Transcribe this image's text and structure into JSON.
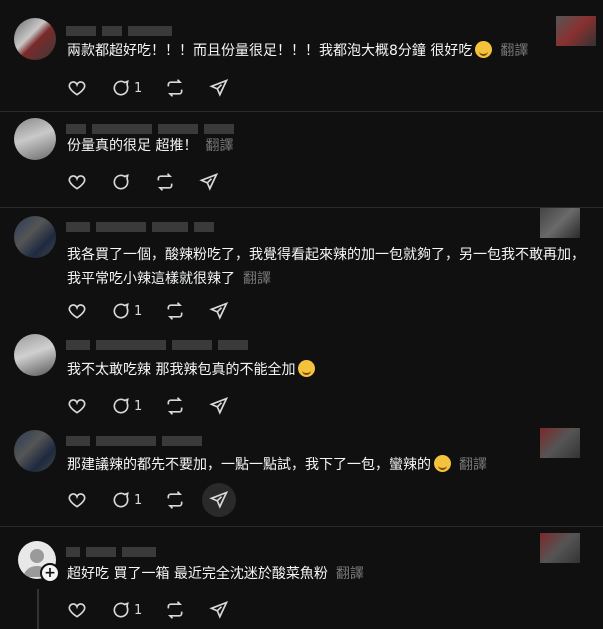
{
  "translate_label": "翻譯",
  "comments": [
    {
      "text": "兩款都超好吃！！！而且份量很足！！！我都泡大概8分鐘 很好吃",
      "emoji": "smiling-face",
      "reply_count": "1",
      "show_reply_count": true
    },
    {
      "text": "份量真的很足 超推！",
      "emoji": "",
      "reply_count": "",
      "show_reply_count": false
    },
    {
      "text": "我各買了一個，酸辣粉吃了，我覺得看起來辣的加一包就夠了，另一包我不敢再加，我平常吃小辣這樣就很辣了",
      "emoji": "",
      "reply_count": "1",
      "show_reply_count": true
    },
    {
      "text": "我不太敢吃辣 那我辣包真的不能全加",
      "emoji": "rolling-laughing-face",
      "reply_count": "1",
      "show_reply_count": true
    },
    {
      "text": "那建議辣的都先不要加，一點一點試，我下了一包，蠻辣的",
      "emoji": "rolling-laughing-face",
      "reply_count": "1",
      "show_reply_count": true
    },
    {
      "text": "超好吃 買了一箱 最近完全沈迷於酸菜魚粉",
      "emoji": "",
      "reply_count": "1",
      "show_reply_count": true
    }
  ],
  "colors": {
    "background": "#101010",
    "text": "#f3f5f7",
    "muted": "#777777",
    "emoji": "#f5c23c"
  },
  "icons": [
    "heart-icon",
    "comment-icon",
    "repost-icon",
    "share-icon",
    "add-icon"
  ]
}
